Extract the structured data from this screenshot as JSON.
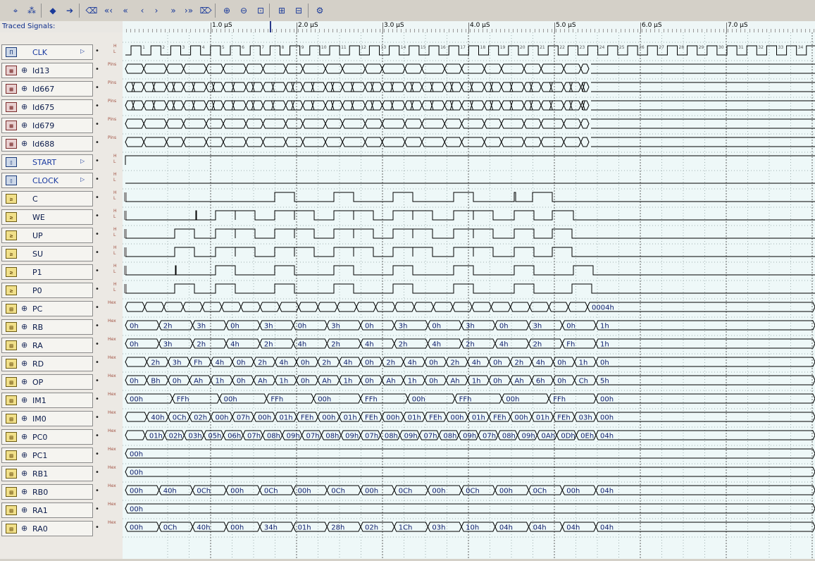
{
  "toolbar": {
    "buttons": [
      {
        "name": "select-tool-button",
        "glyph": "⌖"
      },
      {
        "name": "signal-select-button",
        "glyph": "⁂"
      },
      {
        "name": "back-button",
        "glyph": "◆"
      },
      {
        "name": "forward-button",
        "glyph": "➔"
      },
      {
        "name": "first-edge-button",
        "glyph": "⌫"
      },
      {
        "name": "prev-many-button",
        "glyph": "«‹"
      },
      {
        "name": "prev-fast-button",
        "glyph": "«"
      },
      {
        "name": "prev-edge-button",
        "glyph": "‹"
      },
      {
        "name": "next-edge-button",
        "glyph": "›"
      },
      {
        "name": "next-fast-button",
        "glyph": "»"
      },
      {
        "name": "next-many-button",
        "glyph": "›»"
      },
      {
        "name": "last-edge-button",
        "glyph": "⌦"
      },
      {
        "name": "zoom-in-button",
        "glyph": "⊕"
      },
      {
        "name": "zoom-out-button",
        "glyph": "⊖"
      },
      {
        "name": "zoom-fit-button",
        "glyph": "⊡"
      },
      {
        "name": "add-marker-button",
        "glyph": "⊞"
      },
      {
        "name": "delete-marker-button",
        "glyph": "⊟"
      },
      {
        "name": "settings-button",
        "glyph": "⚙"
      }
    ]
  },
  "panel_title": "Traced Signals:",
  "ruler": {
    "labels": [
      "1.0 µS",
      "2.0 µS",
      "3.0 µS",
      "4.0 µS",
      "5.0 µS",
      "6.0 µS",
      "7.0 µS"
    ]
  },
  "signals": [
    {
      "name": "CLK",
      "icon": "clock",
      "kind": "clock",
      "levels": "H L"
    },
    {
      "name": "Id13",
      "icon": "chip",
      "kind": "bus-pins",
      "levels": "Pins"
    },
    {
      "name": "Id667",
      "icon": "chip",
      "kind": "bus-pins",
      "levels": "Pins"
    },
    {
      "name": "Id675",
      "icon": "chip",
      "kind": "bus-pins",
      "levels": "Pins"
    },
    {
      "name": "Id679",
      "icon": "chip",
      "kind": "bus-pins",
      "levels": "Pins"
    },
    {
      "name": "Id688",
      "icon": "chip",
      "kind": "bus-pins",
      "levels": "Pins"
    },
    {
      "name": "START",
      "icon": "input",
      "kind": "start",
      "levels": "H L"
    },
    {
      "name": "CLOCK",
      "icon": "input",
      "kind": "flat-low",
      "levels": "H L"
    },
    {
      "name": "C",
      "icon": "gate",
      "kind": "bit",
      "levels": "H L"
    },
    {
      "name": "WE",
      "icon": "gate",
      "kind": "bit",
      "levels": "H L"
    },
    {
      "name": "UP",
      "icon": "gate",
      "kind": "bit",
      "levels": "H L"
    },
    {
      "name": "SU",
      "icon": "gate",
      "kind": "bit",
      "levels": "H L"
    },
    {
      "name": "P1",
      "icon": "gate",
      "kind": "bit",
      "levels": "H L"
    },
    {
      "name": "P0",
      "icon": "gate",
      "kind": "bit",
      "levels": "H L"
    },
    {
      "name": "PC",
      "icon": "bus",
      "kind": "hex",
      "levels": "Hex",
      "values": [
        "",
        "",
        "",
        "",
        "",
        "",
        "",
        "",
        "",
        "",
        "",
        "",
        "",
        "",
        "",
        "",
        "",
        "",
        "",
        "",
        "",
        "",
        "",
        "",
        "0004h"
      ]
    },
    {
      "name": "RB",
      "icon": "bus",
      "kind": "hex",
      "levels": "Hex",
      "values": [
        "0h",
        "2h",
        "3h",
        "0h",
        "3h",
        "0h",
        "3h",
        "0h",
        "3h",
        "0h",
        "3h",
        "0h",
        "3h",
        "0h",
        "1h"
      ]
    },
    {
      "name": "RA",
      "icon": "bus",
      "kind": "hex",
      "levels": "Hex",
      "values": [
        "0h",
        "3h",
        "2h",
        "4h",
        "2h",
        "4h",
        "2h",
        "4h",
        "2h",
        "4h",
        "2h",
        "4h",
        "2h",
        "Fh",
        "1h"
      ]
    },
    {
      "name": "RD",
      "icon": "bus",
      "kind": "hex",
      "levels": "Hex",
      "values": [
        "",
        "2h",
        "3h",
        "Fh",
        "4h",
        "0h",
        "2h",
        "4h",
        "0h",
        "2h",
        "4h",
        "0h",
        "2h",
        "4h",
        "0h",
        "2h",
        "4h",
        "0h",
        "2h",
        "4h",
        "0h",
        "1h",
        "0h"
      ]
    },
    {
      "name": "OP",
      "icon": "bus",
      "kind": "hex",
      "levels": "Hex",
      "values": [
        "0h",
        "Bh",
        "0h",
        "Ah",
        "1h",
        "0h",
        "Ah",
        "1h",
        "0h",
        "Ah",
        "1h",
        "0h",
        "Ah",
        "1h",
        "0h",
        "Ah",
        "1h",
        "0h",
        "Ah",
        "6h",
        "0h",
        "Ch",
        "5h"
      ]
    },
    {
      "name": "IM1",
      "icon": "bus",
      "kind": "hex",
      "levels": "Hex",
      "values": [
        "00h",
        "FFh",
        "00h",
        "FFh",
        "00h",
        "FFh",
        "00h",
        "FFh",
        "00h",
        "FFh",
        "00h"
      ]
    },
    {
      "name": "IM0",
      "icon": "bus",
      "kind": "hex",
      "levels": "Hex",
      "values": [
        "",
        "40h",
        "0Ch",
        "02h",
        "00h",
        "07h",
        "00h",
        "01h",
        "FEh",
        "00h",
        "01h",
        "FEh",
        "00h",
        "01h",
        "FEh",
        "00h",
        "01h",
        "FEh",
        "00h",
        "01h",
        "FEh",
        "03h",
        "00h"
      ]
    },
    {
      "name": "PC0",
      "icon": "bus",
      "kind": "hex",
      "levels": "Hex",
      "values": [
        "",
        "01h",
        "02h",
        "03h",
        "05h",
        "06h",
        "07h",
        "08h",
        "09h",
        "07h",
        "08h",
        "09h",
        "07h",
        "08h",
        "09h",
        "07h",
        "08h",
        "09h",
        "07h",
        "08h",
        "09h",
        "0Ah",
        "0Dh",
        "0Eh",
        "04h"
      ]
    },
    {
      "name": "PC1",
      "icon": "bus",
      "kind": "hex",
      "levels": "Hex",
      "values": [
        "00h"
      ]
    },
    {
      "name": "RB1",
      "icon": "bus",
      "kind": "hex",
      "levels": "Hex",
      "values": [
        "00h"
      ]
    },
    {
      "name": "RB0",
      "icon": "bus",
      "kind": "hex",
      "levels": "Hex",
      "values": [
        "00h",
        "40h",
        "0Ch",
        "00h",
        "0Ch",
        "00h",
        "0Ch",
        "00h",
        "0Ch",
        "00h",
        "0Ch",
        "00h",
        "0Ch",
        "00h",
        "04h"
      ]
    },
    {
      "name": "RA1",
      "icon": "bus",
      "kind": "hex",
      "levels": "Hex",
      "values": [
        "00h"
      ]
    },
    {
      "name": "RA0",
      "icon": "bus",
      "kind": "hex",
      "levels": "Hex",
      "values": [
        "00h",
        "0Ch",
        "40h",
        "00h",
        "34h",
        "01h",
        "28h",
        "02h",
        "1Ch",
        "03h",
        "10h",
        "04h",
        "04h",
        "04h",
        "04h"
      ]
    }
  ]
}
